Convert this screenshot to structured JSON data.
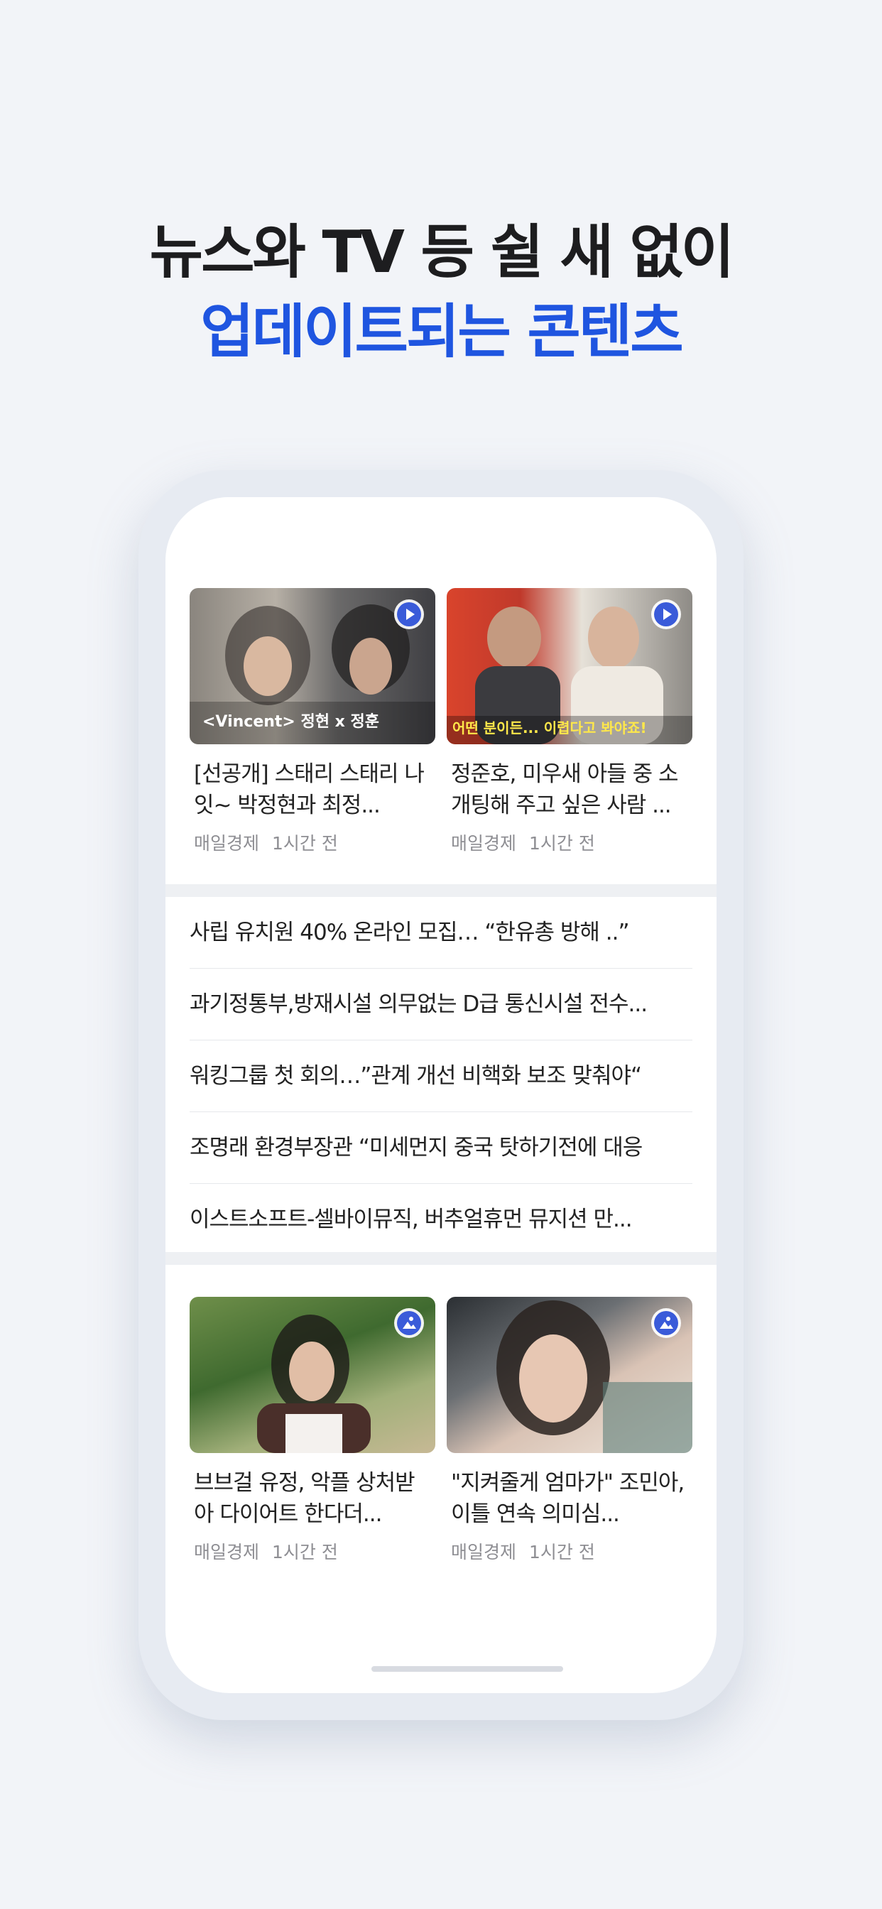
{
  "headline": {
    "line1": "뉴스와 TV 등 쉴 새 없이",
    "line2": "업데이트되는 콘텐츠"
  },
  "colors": {
    "accent": "#1f55e0",
    "headline": "#1d1d1f",
    "background": "#f2f4f8"
  },
  "video_cards": [
    {
      "title": "[선공개] 스태리 스태리 나잇~ 박정현과 최정...",
      "source": "매일경제",
      "time": "1시간 전",
      "overlay": "<Vincent> 정현 x 정훈",
      "badge_icon": "play-icon"
    },
    {
      "title": "정준호, 미우새 아들 중 소개팅해 주고 싶은 사람 ...",
      "source": "매일경제",
      "time": "1시간 전",
      "overlay": "어떤 분이든... 이렵다고 봐야죠!",
      "badge_icon": "play-icon"
    }
  ],
  "news_list": [
    "사립 유치원 40% 온라인 모집… “한유총 방해 ..”",
    "과기정통부,방재시설 의무없는 D급 통신시설 전수...",
    "워킹그룹 첫 회의…”관계 개선 비핵화 보조 맞춰야“",
    "조명래 환경부장관 “미세먼지 중국 탓하기전에 대응",
    "이스트소프트-셀바이뮤직, 버추얼휴먼 뮤지션 만..."
  ],
  "photo_cards": [
    {
      "title": "브브걸 유정, 악플 상처받아 다이어트 한다더...",
      "source": "매일경제",
      "time": "1시간 전",
      "badge_icon": "image-icon"
    },
    {
      "title": "\"지켜줄게 엄마가\" 조민아, 이틀 연속 의미심...",
      "source": "매일경제",
      "time": "1시간 전",
      "badge_icon": "image-icon"
    }
  ]
}
